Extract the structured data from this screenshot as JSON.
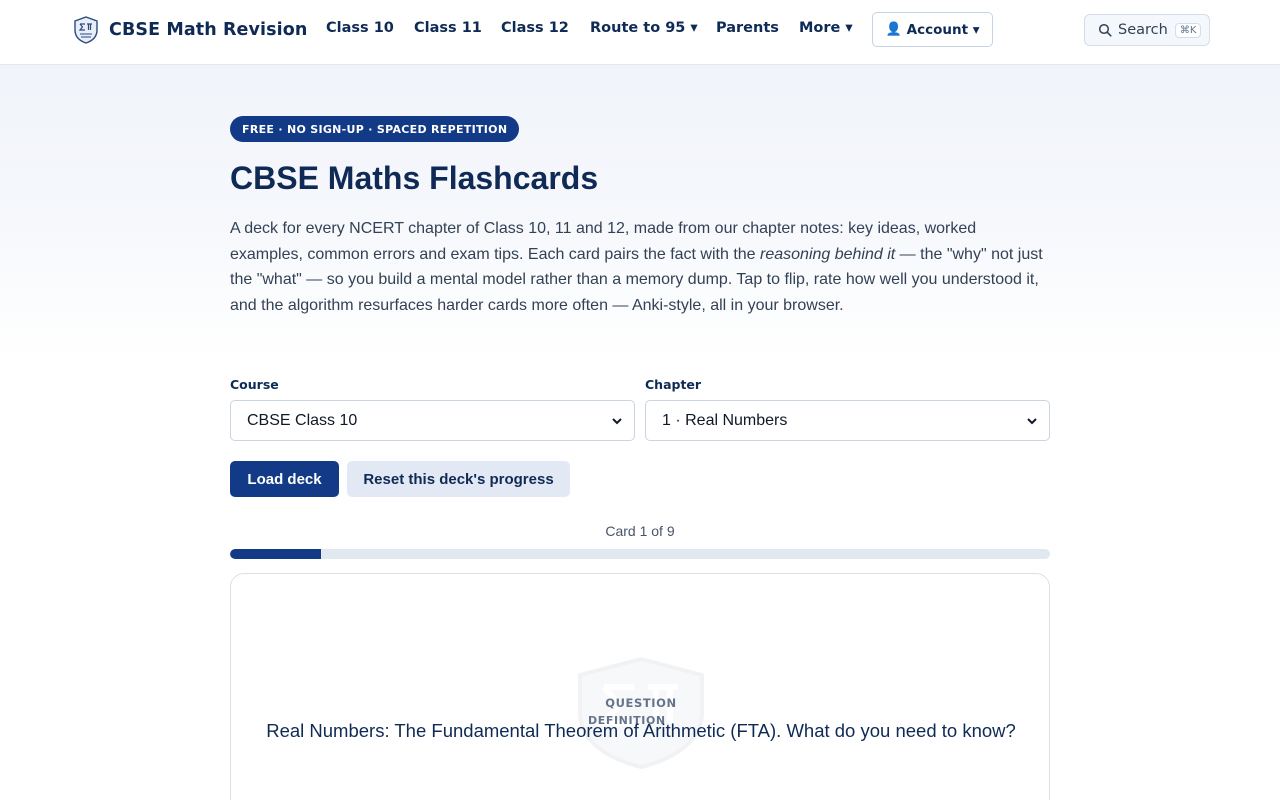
{
  "header": {
    "brand": "CBSE Math Revision",
    "nav": [
      {
        "label": "Class 10"
      },
      {
        "label": "Class 11"
      },
      {
        "label": "Class 12"
      },
      {
        "label": "Route to 95 ▾"
      },
      {
        "label": "Parents"
      },
      {
        "label": "More ▾"
      }
    ],
    "account_label": "Account ▾",
    "search_label": "Search",
    "search_shortcut": "⌘K"
  },
  "hero": {
    "badge": "FREE · NO SIGN-UP · SPACED REPETITION",
    "title": "CBSE Maths Flashcards",
    "intro_part1": "A deck for every NCERT chapter of Class 10, 11 and 12, made from our chapter notes: key ideas, worked examples, common errors and exam tips. Each card pairs the fact with the ",
    "intro_emphasis": "reasoning behind it",
    "intro_part2": " — the \"why\" not just the \"what\" — so you build a mental model rather than a memory dump. Tap to flip, rate how well you understood it, and the algorithm resurfaces harder cards more often — Anki-style, all in your browser."
  },
  "controls": {
    "course_label": "Course",
    "course_value": "CBSE Class 10",
    "chapter_label": "Chapter",
    "chapter_value": "1 · Real Numbers",
    "load_button": "Load deck",
    "reset_button": "Reset this deck's progress"
  },
  "progress": {
    "counter_text": "Card 1 of 9",
    "fraction": 0.111
  },
  "card": {
    "side_label": "QUESTION",
    "type_label": "DEFINITION",
    "question": "Real Numbers: The Fundamental Theorem of Arithmetic (FTA). What do you need to know?"
  },
  "colors": {
    "primary": "#123a86",
    "heading": "#0f2a55"
  },
  "icons": {
    "brand": "sigma-pi-shield-icon",
    "account": "user-icon",
    "search": "search-icon",
    "select": "chevron-down-icon"
  }
}
